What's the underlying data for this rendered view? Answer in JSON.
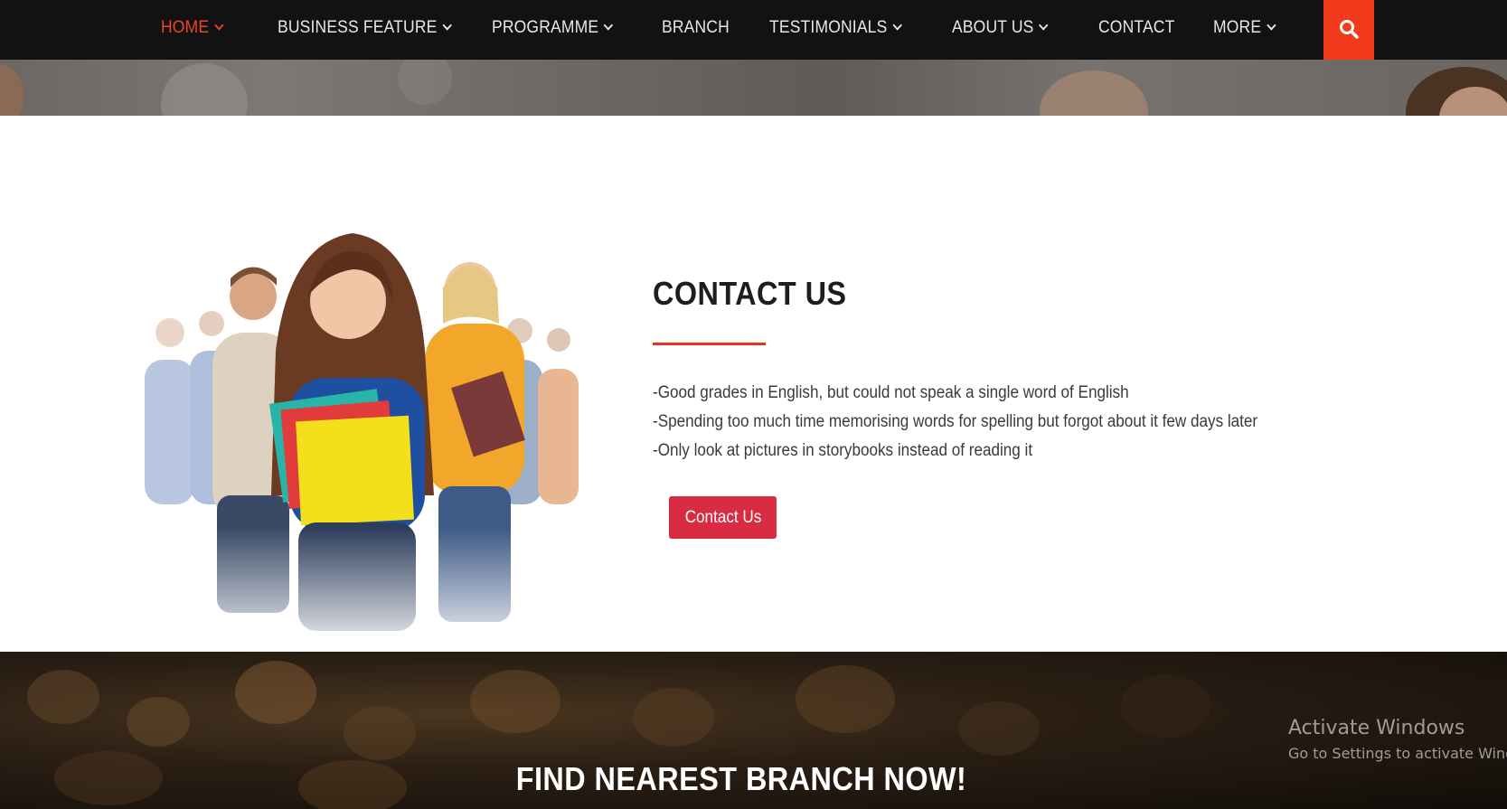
{
  "nav": {
    "items": [
      {
        "label": "HOME",
        "dropdown": true,
        "active": true
      },
      {
        "label": "BUSINESS FEATURE",
        "dropdown": true,
        "active": false
      },
      {
        "label": "PROGRAMME",
        "dropdown": true,
        "active": false
      },
      {
        "label": "BRANCH",
        "dropdown": false,
        "active": false
      },
      {
        "label": "TESTIMONIALS",
        "dropdown": true,
        "active": false
      },
      {
        "label": "ABOUT US",
        "dropdown": true,
        "active": false
      },
      {
        "label": "CONTACT",
        "dropdown": false,
        "active": false
      },
      {
        "label": "MORE",
        "dropdown": true,
        "active": false
      }
    ],
    "search_icon": "search-icon"
  },
  "contact": {
    "title": "CONTACT US",
    "lines": [
      "-Good grades in English, but could not speak a single word of English",
      "-Spending too much time memorising words for spelling but forgot about it few days later",
      "-Only look at pictures in storybooks instead of reading it"
    ],
    "button_label": "Contact Us"
  },
  "branch": {
    "title": "FIND NEAREST BRANCH NOW!"
  },
  "watermark": {
    "title": "Activate Windows",
    "subtitle": "Go to Settings to activate Windows."
  },
  "colors": {
    "nav_bg": "#121212",
    "accent": "#f0432a",
    "search_bg": "#f23a1d",
    "button_bg": "#d92b42"
  }
}
